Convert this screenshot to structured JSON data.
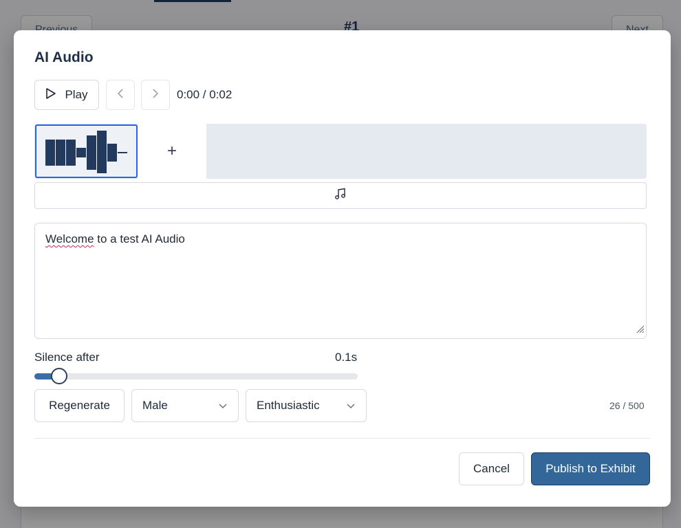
{
  "background": {
    "prev_label": "Previous",
    "next_label": "Next",
    "item_number": "#1"
  },
  "modal": {
    "title": "AI Audio",
    "player": {
      "play_label": "Play",
      "time": "0:00 / 0:02"
    },
    "track": {
      "add_label": "+"
    },
    "text": {
      "misspelled_word": "Welcome",
      "rest": " to a test AI Audio"
    },
    "silence": {
      "label": "Silence after",
      "value": "0.1s",
      "fraction": 0.05
    },
    "controls": {
      "regenerate_label": "Regenerate",
      "voice": "Male",
      "tone": "Enthusiastic",
      "char_count": "26 / 500"
    },
    "footer": {
      "cancel_label": "Cancel",
      "publish_label": "Publish to Exhibit"
    },
    "colors": {
      "accent": "#336699",
      "selected_border": "#2563eb",
      "waveform": "#223a5e"
    }
  }
}
